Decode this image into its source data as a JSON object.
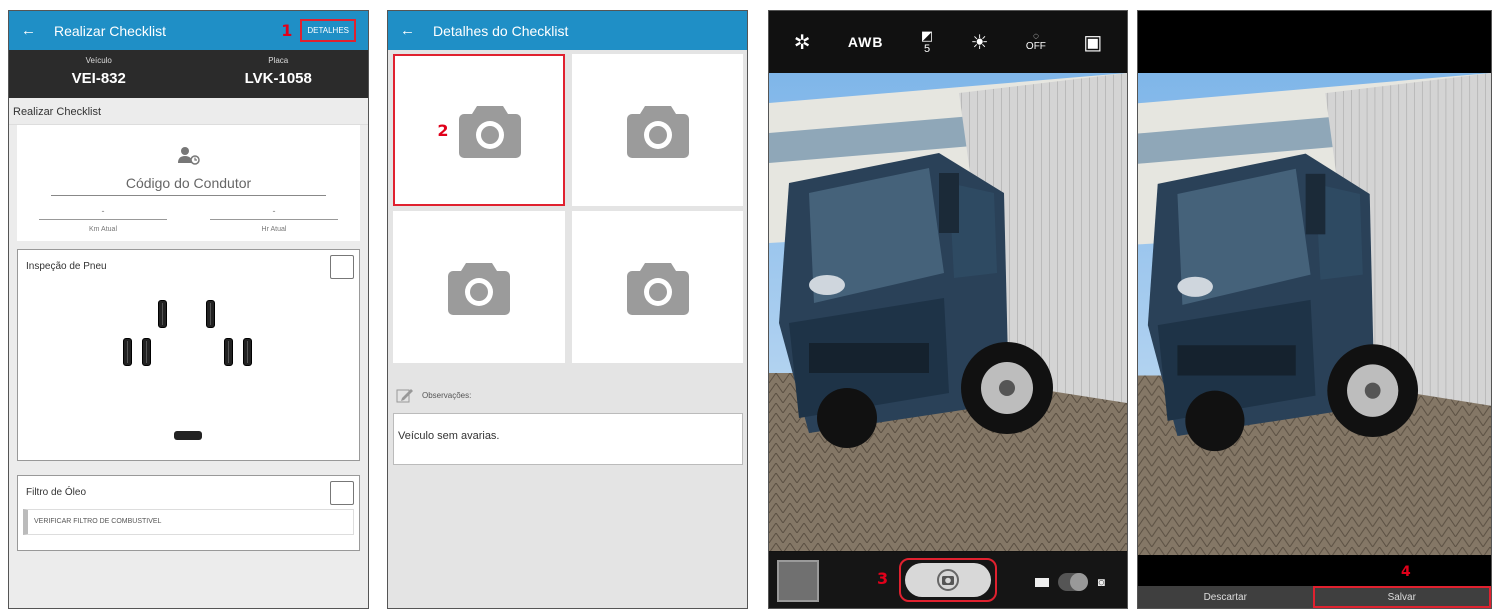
{
  "panel1": {
    "appbar": {
      "back_icon": "arrow-left-icon",
      "title": "Realizar Checklist",
      "annotation": "1",
      "details_label": "DETALHES"
    },
    "vehicle": {
      "vehicle_label": "Veículo",
      "vehicle_value": "VEI-832",
      "plate_label": "Placa",
      "plate_value": "LVK-1058"
    },
    "section_title": "Realizar Checklist",
    "driver": {
      "icon": "driver-icon",
      "code_placeholder": "Código do Condutor"
    },
    "km": {
      "value": "-",
      "label": "Km Atual"
    },
    "hr": {
      "value": "-",
      "label": "Hr Atual"
    },
    "tire_inspection": {
      "title": "Inspeção de Pneu"
    },
    "oil_filter": {
      "title": "Filtro de Óleo",
      "item": "VERIFICAR FILTRO DE COMBUSTIVEL"
    }
  },
  "panel2": {
    "appbar": {
      "back_icon": "arrow-left-icon",
      "title": "Detalhes do Checklist"
    },
    "annotation": "2",
    "observations_label": "Observações:",
    "observations_text": "Veículo sem avarias."
  },
  "panel3": {
    "top_icons": [
      "settings-icon",
      "awb-icon",
      "exposure-icon",
      "brightness-icon",
      "timer-off-icon",
      "aspect-ratio-icon"
    ],
    "awb_text": "AWB",
    "exposure_value": "5",
    "timer_text": "OFF",
    "annotation": "3"
  },
  "panel4": {
    "annotation": "4",
    "discard_label": "Descartar",
    "save_label": "Salvar"
  },
  "colors": {
    "appbar": "#1f8fc6",
    "annotation": "#e0212f",
    "icon_gray": "#9b9b9b"
  }
}
